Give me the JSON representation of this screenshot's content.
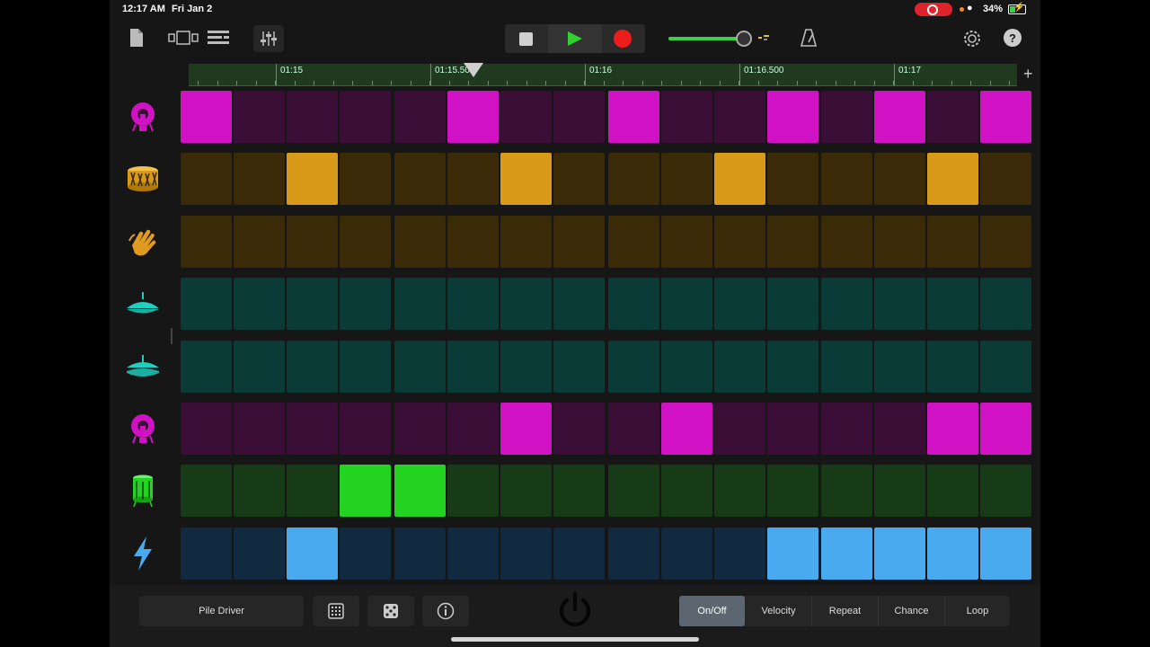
{
  "status_bar": {
    "time": "12:17 AM",
    "date": "Fri Jan 2",
    "battery": "34%"
  },
  "toolbar": {
    "icons": [
      "document-icon",
      "view-toggle-icon",
      "tracks-list-icon",
      "mixer-icon",
      "settings-icon",
      "help-icon",
      "metronome-icon"
    ],
    "help_label": "?"
  },
  "ruler": {
    "labels": [
      "01:15",
      "01:15.500",
      "01:16",
      "01:16.500",
      "01:17"
    ]
  },
  "tracks": [
    {
      "icon": "kick-drum-icon",
      "off": "#3a0e36",
      "on": "#d011c4",
      "steps": [
        1,
        0,
        0,
        0,
        0,
        1,
        0,
        0,
        1,
        0,
        0,
        1,
        0,
        1,
        0,
        1
      ]
    },
    {
      "icon": "snare-drum-icon",
      "off": "#3a2a08",
      "on": "#d89a18",
      "steps": [
        0,
        0,
        1,
        0,
        0,
        0,
        1,
        0,
        0,
        0,
        1,
        0,
        0,
        0,
        1,
        0
      ]
    },
    {
      "icon": "clap-hand-icon",
      "off": "#3a2a08",
      "on": "#d89a18",
      "steps": [
        0,
        0,
        0,
        0,
        0,
        0,
        0,
        0,
        0,
        0,
        0,
        0,
        0,
        0,
        0,
        0
      ]
    },
    {
      "icon": "hi-hat-closed-icon",
      "off": "#0b3b36",
      "on": "#1fd0c0",
      "steps": [
        0,
        0,
        0,
        0,
        0,
        0,
        0,
        0,
        0,
        0,
        0,
        0,
        0,
        0,
        0,
        0
      ]
    },
    {
      "icon": "hi-hat-open-icon",
      "off": "#0b3b36",
      "on": "#1fd0c0",
      "steps": [
        0,
        0,
        0,
        0,
        0,
        0,
        0,
        0,
        0,
        0,
        0,
        0,
        0,
        0,
        0,
        0
      ]
    },
    {
      "icon": "kick-drum-icon",
      "off": "#3a0e36",
      "on": "#d011c4",
      "steps": [
        0,
        0,
        0,
        0,
        0,
        0,
        1,
        0,
        0,
        1,
        0,
        0,
        0,
        0,
        1,
        1
      ]
    },
    {
      "icon": "tom-drum-icon",
      "off": "#163b16",
      "on": "#22d322",
      "steps": [
        0,
        0,
        0,
        1,
        1,
        0,
        0,
        0,
        0,
        0,
        0,
        0,
        0,
        0,
        0,
        0
      ]
    },
    {
      "icon": "lightning-bolt-icon",
      "off": "#122a40",
      "on": "#4aaaf0",
      "steps": [
        0,
        0,
        1,
        0,
        0,
        0,
        0,
        0,
        0,
        0,
        0,
        1,
        1,
        1,
        1,
        1
      ]
    }
  ],
  "bottom": {
    "kit_name": "Pile Driver",
    "modes": [
      "On/Off",
      "Velocity",
      "Repeat",
      "Chance",
      "Loop"
    ],
    "active_mode": "On/Off"
  }
}
